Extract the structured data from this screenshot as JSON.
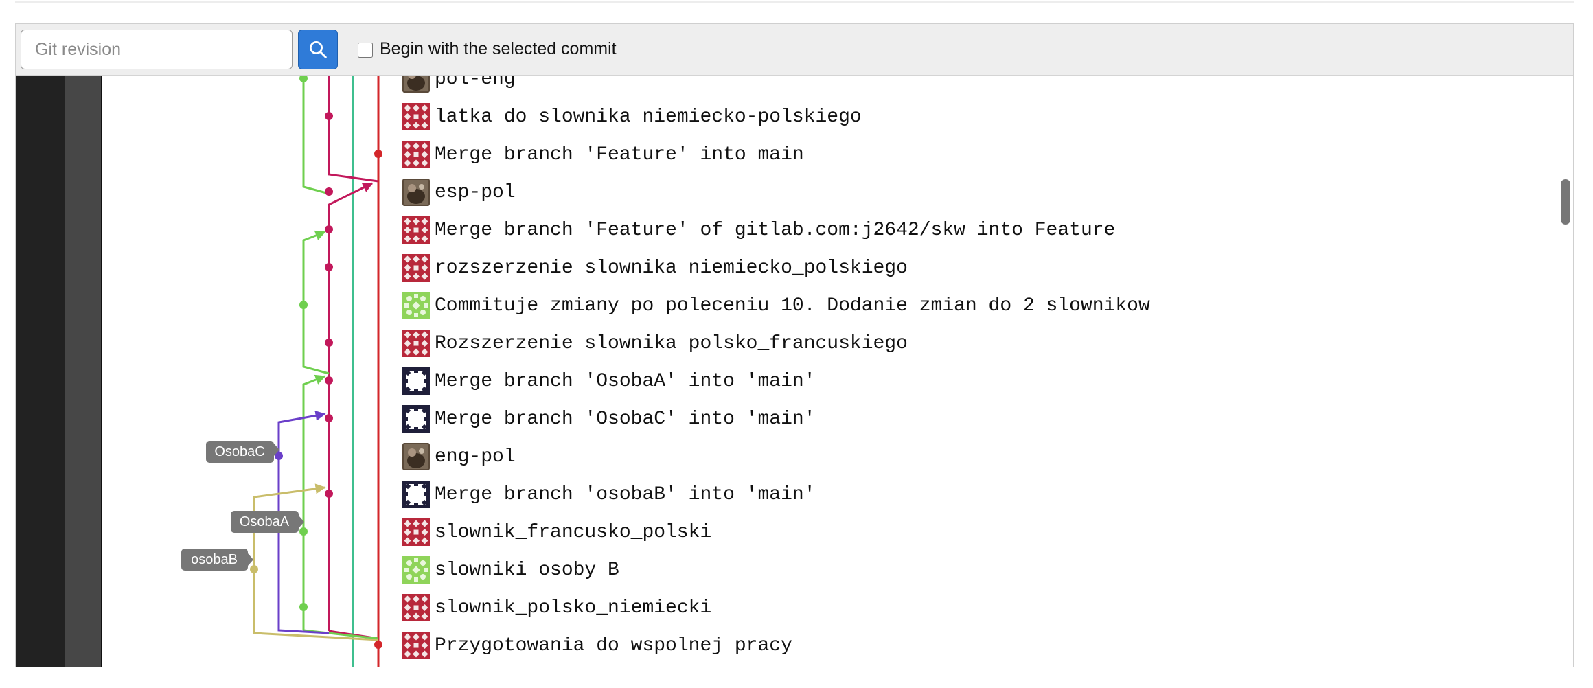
{
  "toolbar": {
    "revision_placeholder": "Git revision",
    "search_icon": "search-icon",
    "checkbox_label": "Begin with the selected commit",
    "checkbox_checked": false
  },
  "graph": {
    "colors": {
      "main": "#d3262a",
      "feature": "#c2185b",
      "teal": "#3fbf8f",
      "green": "#6fcf4f",
      "purple": "#6a3fc9",
      "olive": "#c9bd6a"
    },
    "labels": [
      "OsobaC",
      "OsobaA",
      "osobaB"
    ]
  },
  "commits": [
    {
      "message": "pol-eng",
      "avatar": "photo"
    },
    {
      "message": "latka do slownika niemiecko-polskiego",
      "avatar": "red-pattern"
    },
    {
      "message": "Merge branch 'Feature' into main",
      "avatar": "red-pattern"
    },
    {
      "message": "esp-pol",
      "avatar": "photo"
    },
    {
      "message": "Merge branch 'Feature' of gitlab.com:j2642/skw into Feature",
      "avatar": "red-pattern"
    },
    {
      "message": "rozszerzenie slownika niemiecko_polskiego",
      "avatar": "red-pattern"
    },
    {
      "message": "Commituje zmiany po poleceniu 10. Dodanie zmian do 2 slownikow",
      "avatar": "green-pattern"
    },
    {
      "message": "Rozszerzenie slownika polsko_francuskiego",
      "avatar": "red-pattern"
    },
    {
      "message": "Merge branch 'OsobaA' into 'main'",
      "avatar": "dark-pattern"
    },
    {
      "message": "Merge branch 'OsobaC' into 'main'",
      "avatar": "dark-pattern"
    },
    {
      "message": "eng-pol",
      "avatar": "photo"
    },
    {
      "message": "Merge branch 'osobaB' into 'main'",
      "avatar": "dark-pattern"
    },
    {
      "message": "slownik_francusko_polski",
      "avatar": "red-pattern"
    },
    {
      "message": "slowniki osoby B",
      "avatar": "green-pattern"
    },
    {
      "message": "slownik_polsko_niemiecki",
      "avatar": "red-pattern"
    },
    {
      "message": "Przygotowania do wspolnej pracy",
      "avatar": "red-pattern"
    }
  ]
}
